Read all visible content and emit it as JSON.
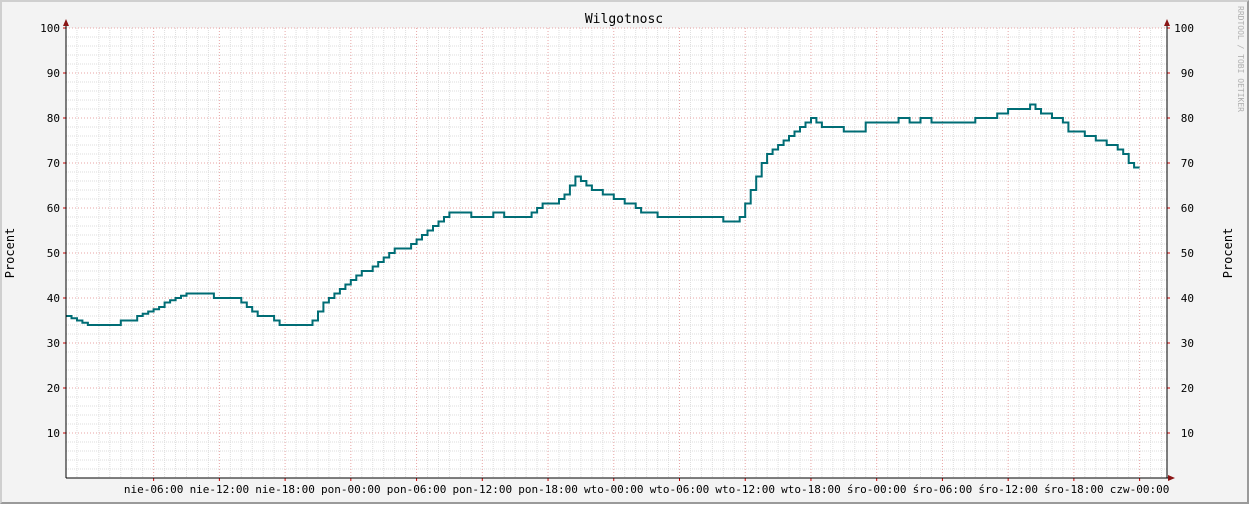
{
  "chart_data": {
    "type": "line",
    "title": "Wilgotnosc",
    "ylabel": "Procent",
    "ylabel_right": "Procent",
    "watermark": "RRDTOOL / TOBI OETIKER",
    "ylim": [
      0,
      100
    ],
    "yticks": [
      10,
      20,
      30,
      40,
      50,
      60,
      70,
      80,
      90,
      100
    ],
    "xlabels": [
      "nie-06:00",
      "nie-12:00",
      "nie-18:00",
      "pon-00:00",
      "pon-06:00",
      "pon-12:00",
      "pon-18:00",
      "wto-00:00",
      "wto-06:00",
      "wto-12:00",
      "wto-18:00",
      "śro-00:00",
      "śro-06:00",
      "śro-12:00",
      "śro-18:00",
      "czw-00:00"
    ],
    "x_unit": "hours from nie-00:00",
    "xlim": [
      -2,
      98.5
    ],
    "grid": true,
    "series": [
      {
        "color": "#006d75",
        "points": [
          [
            -2,
            36
          ],
          [
            -1.5,
            35.5
          ],
          [
            -1,
            35
          ],
          [
            -0.5,
            34.5
          ],
          [
            0,
            34
          ],
          [
            1,
            34
          ],
          [
            2.5,
            34
          ],
          [
            3,
            35
          ],
          [
            4,
            35
          ],
          [
            4.5,
            36
          ],
          [
            5,
            36.5
          ],
          [
            5.5,
            37
          ],
          [
            6,
            37.5
          ],
          [
            6.5,
            38
          ],
          [
            7,
            39
          ],
          [
            7.5,
            39.5
          ],
          [
            8,
            40
          ],
          [
            8.5,
            40.5
          ],
          [
            9,
            41
          ],
          [
            10,
            41
          ],
          [
            11,
            41
          ],
          [
            11.5,
            40
          ],
          [
            12,
            40
          ],
          [
            13,
            40
          ],
          [
            14,
            39
          ],
          [
            14.5,
            38
          ],
          [
            15,
            37
          ],
          [
            15.5,
            36
          ],
          [
            16,
            36
          ],
          [
            17,
            35
          ],
          [
            17.5,
            34
          ],
          [
            18,
            34
          ],
          [
            19,
            34
          ],
          [
            20,
            34
          ],
          [
            20.5,
            35
          ],
          [
            21,
            37
          ],
          [
            21.5,
            39
          ],
          [
            22,
            40
          ],
          [
            22.5,
            41
          ],
          [
            23,
            42
          ],
          [
            23.5,
            43
          ],
          [
            24,
            44
          ],
          [
            24.5,
            45
          ],
          [
            25,
            46
          ],
          [
            25.5,
            46
          ],
          [
            26,
            47
          ],
          [
            26.5,
            48
          ],
          [
            27,
            49
          ],
          [
            27.5,
            50
          ],
          [
            28,
            51
          ],
          [
            29,
            51
          ],
          [
            29.5,
            52
          ],
          [
            30,
            53
          ],
          [
            30.5,
            54
          ],
          [
            31,
            55
          ],
          [
            31.5,
            56
          ],
          [
            32,
            57
          ],
          [
            32.5,
            58
          ],
          [
            33,
            59
          ],
          [
            34,
            59
          ],
          [
            35,
            58
          ],
          [
            36,
            58
          ],
          [
            37,
            59
          ],
          [
            38,
            58
          ],
          [
            39,
            58
          ],
          [
            40,
            58
          ],
          [
            40.5,
            59
          ],
          [
            41,
            60
          ],
          [
            41.5,
            61
          ],
          [
            42,
            61
          ],
          [
            43,
            62
          ],
          [
            43.5,
            63
          ],
          [
            44,
            65
          ],
          [
            44.5,
            67
          ],
          [
            45,
            66
          ],
          [
            45.5,
            65
          ],
          [
            46,
            64
          ],
          [
            46.5,
            64
          ],
          [
            47,
            63
          ],
          [
            48,
            62
          ],
          [
            49,
            61
          ],
          [
            50,
            60
          ],
          [
            50.5,
            59
          ],
          [
            51,
            59
          ],
          [
            52,
            58
          ],
          [
            53,
            58
          ],
          [
            54,
            58
          ],
          [
            55,
            58
          ],
          [
            56,
            58
          ],
          [
            57,
            58
          ],
          [
            58,
            57
          ],
          [
            59,
            57
          ],
          [
            59.5,
            58
          ],
          [
            60,
            61
          ],
          [
            60.5,
            64
          ],
          [
            61,
            67
          ],
          [
            61.5,
            70
          ],
          [
            62,
            72
          ],
          [
            62.5,
            73
          ],
          [
            63,
            74
          ],
          [
            63.5,
            75
          ],
          [
            64,
            76
          ],
          [
            64.5,
            77
          ],
          [
            65,
            78
          ],
          [
            65.5,
            79
          ],
          [
            66,
            80
          ],
          [
            66.5,
            79
          ],
          [
            67,
            78
          ],
          [
            68,
            78
          ],
          [
            69,
            77
          ],
          [
            70,
            77
          ],
          [
            71,
            79
          ],
          [
            72,
            79
          ],
          [
            73,
            79
          ],
          [
            74,
            80
          ],
          [
            75,
            79
          ],
          [
            76,
            80
          ],
          [
            77,
            79
          ],
          [
            78,
            79
          ],
          [
            79,
            79
          ],
          [
            80,
            79
          ],
          [
            81,
            80
          ],
          [
            82,
            80
          ],
          [
            83,
            81
          ],
          [
            84,
            82
          ],
          [
            85,
            82
          ],
          [
            86,
            83
          ],
          [
            86.5,
            82
          ],
          [
            87,
            81
          ],
          [
            88,
            80
          ],
          [
            89,
            79
          ],
          [
            89.5,
            77
          ],
          [
            90,
            77
          ],
          [
            91,
            76
          ],
          [
            92,
            75
          ],
          [
            93,
            74
          ],
          [
            94,
            73
          ],
          [
            94.5,
            72
          ],
          [
            95,
            70
          ],
          [
            95.5,
            69
          ],
          [
            96,
            69
          ]
        ]
      }
    ]
  }
}
